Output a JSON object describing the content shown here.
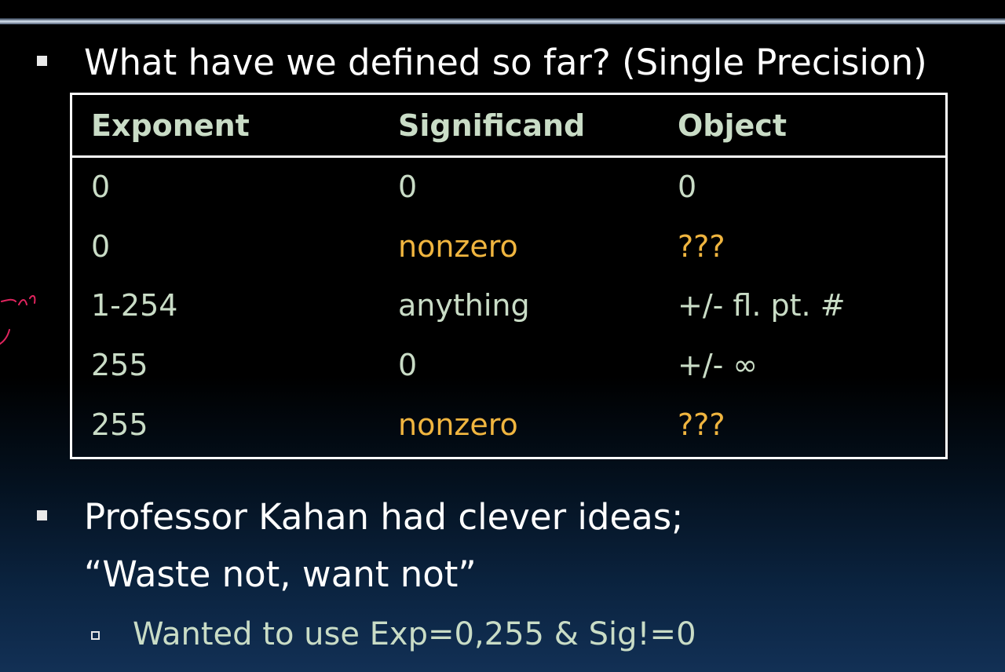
{
  "slide": {
    "bullet1": "What have we defined so far? (Single Precision)",
    "bullet2_line1": "Professor Kahan had clever ideas;",
    "bullet2_line2": "“Waste not, want not”",
    "sub_bullet": "Wanted to use Exp=0,255 & Sig!=0"
  },
  "table": {
    "headers": [
      "Exponent",
      "Significand",
      "Object"
    ],
    "rows": [
      [
        "0",
        "0",
        "0"
      ],
      [
        "0",
        "nonzero",
        "???"
      ],
      [
        "1-254",
        "anything",
        "+/- fl. pt. #"
      ],
      [
        "255",
        "0",
        "+/- ∞"
      ],
      [
        "255",
        "nonzero",
        "???"
      ]
    ]
  },
  "colors": {
    "background": "#000000",
    "text": "#ffffff",
    "table_text": "#c9dcc6",
    "highlight": "#f0b53f",
    "ink_annotation": "#e0245e"
  }
}
